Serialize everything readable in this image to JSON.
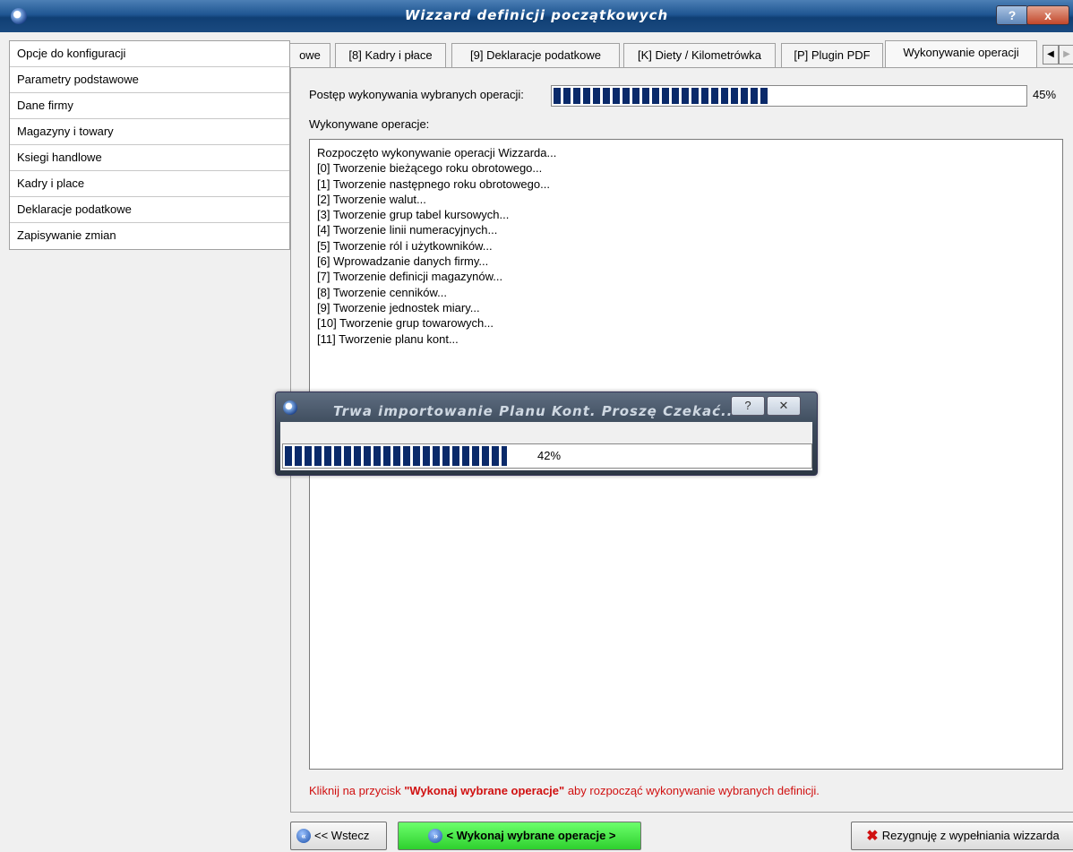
{
  "window": {
    "title": "Wizzard definicji początkowych",
    "help_btn": "?",
    "close_btn": "x"
  },
  "sidebar": {
    "items": [
      "Opcje do konfiguracji",
      "Parametry podstawowe",
      "Dane firmy",
      "Magazyny i towary",
      "Ksiegi handlowe",
      "Kadry i place",
      "Deklaracje podatkowe",
      "Zapisywanie zmian"
    ]
  },
  "tabs": [
    {
      "label": "owe"
    },
    {
      "label": "[8] Kadry i płace"
    },
    {
      "label": "[9] Deklaracje podatkowe"
    },
    {
      "label": "[K] Diety / Kilometrówka"
    },
    {
      "label": "[P] Plugin PDF"
    },
    {
      "label": "Wykonywanie operacji"
    }
  ],
  "progress": {
    "label": "Postęp wykonywania wybranych operacji:",
    "value": 0.45,
    "pct_text": "45%",
    "color": "#0a2a6a"
  },
  "operations": {
    "label": "Wykonywane operacje:",
    "lines": [
      "Rozpoczęto wykonywanie operacji Wizzarda...",
      "[0] Tworzenie bieżącego roku obrotowego...",
      "[1] Tworzenie następnego roku obrotowego...",
      "[2] Tworzenie walut...",
      "[3] Tworzenie grup tabel kursowych...",
      "[4] Tworzenie linii numeracyjnych...",
      "[5] Tworzenie ról i użytkowników...",
      "[6] Wprowadzanie danych firmy...",
      "[7] Tworzenie definicji magazynów...",
      "[8] Tworzenie cenników...",
      "[9] Tworzenie jednostek miary...",
      "[10] Tworzenie grup towarowych...",
      "[11] Tworzenie planu kont..."
    ]
  },
  "hint": {
    "pre": "Kliknij na przycisk ",
    "bold": "\"Wykonaj wybrane operacje\"",
    "post": " aby rozpocząć wykonywanie wybranych definicji."
  },
  "buttons": {
    "back": "<< Wstecz",
    "execute": "< Wykonaj wybrane operacje >",
    "cancel": "Rezygnuję z wypełniania wizzarda"
  },
  "dialog": {
    "title": "Trwa importowanie Planu Kont. Proszę Czekać...",
    "help_btn": "?",
    "close_btn": "✕",
    "progress_value": 0.42,
    "pct_text": "42%"
  }
}
